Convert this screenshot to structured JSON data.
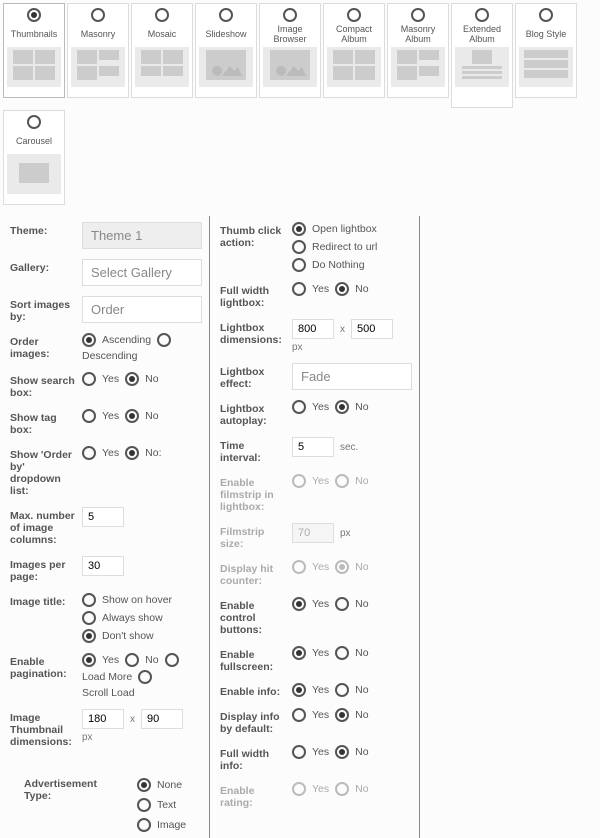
{
  "layouts": [
    {
      "label": "Thumbnails",
      "preview": "grid",
      "selected": true
    },
    {
      "label": "Masonry",
      "preview": "masonry",
      "selected": false
    },
    {
      "label": "Mosaic",
      "preview": "mosaic",
      "selected": false
    },
    {
      "label": "Slideshow",
      "preview": "single",
      "selected": false
    },
    {
      "label": "Image Browser",
      "preview": "single",
      "selected": false
    },
    {
      "label": "Compact Album",
      "preview": "grid",
      "selected": false
    },
    {
      "label": "Masonry Album",
      "preview": "masonry",
      "selected": false
    },
    {
      "label": "Extended Album",
      "preview": "extended",
      "selected": false
    },
    {
      "label": "Blog Style",
      "preview": "blog",
      "selected": false
    },
    {
      "label": "Carousel",
      "preview": "carousel",
      "selected": false
    }
  ],
  "left": {
    "theme_label": "Theme:",
    "theme_value": "Theme 1",
    "gallery_label": "Gallery:",
    "gallery_value": "Select Gallery",
    "sort_label": "Sort images by:",
    "sort_value": "Order",
    "order_label": "Order images:",
    "order_asc": "Ascending",
    "order_desc": "Descending",
    "searchbox_label": "Show search box:",
    "yes": "Yes",
    "no": "No",
    "tagbox_label": "Show tag box:",
    "orderby_label": "Show 'Order by' dropdown list:",
    "no_colon": "No:",
    "maxcols_label": "Max. number of image columns:",
    "maxcols_value": "5",
    "perpage_label": "Images per page:",
    "perpage_value": "30",
    "imgtitle_label": "Image title:",
    "imgtitle_hover": "Show on hover",
    "imgtitle_always": "Always show",
    "imgtitle_dont": "Don't show",
    "pagination_label": "Enable pagination:",
    "pag_yes": "Yes",
    "pag_no": "No",
    "pag_loadmore": "Load More",
    "pag_scroll": "Scroll Load",
    "thumbdim_label": "Image Thumbnail dimensions:",
    "thumb_w": "180",
    "x": "x",
    "thumb_h": "90",
    "px": "px"
  },
  "right": {
    "thumbclick_label": "Thumb click action:",
    "open_lb": "Open lightbox",
    "redirect": "Redirect to url",
    "donothing": "Do Nothing",
    "fullwidth_lb_label": "Full width lightbox:",
    "yes": "Yes",
    "no": "No",
    "lbdim_label": "Lightbox dimensions:",
    "lb_w": "800",
    "x": "x",
    "lb_h": "500",
    "px": "px",
    "lbeffect_label": "Lightbox effect:",
    "lbeffect_value": "Fade",
    "lbautoplay_label": "Lightbox autoplay:",
    "interval_label": "Time interval:",
    "interval_value": "5",
    "sec": "sec.",
    "filmstrip_label": "Enable filmstrip in lightbox:",
    "filmsize_label": "Filmstrip size:",
    "filmsize_value": "70",
    "hitcounter_label": "Display hit counter:",
    "ctrlbtn_label": "Enable control buttons:",
    "fullscreen_label": "Enable fullscreen:",
    "info_label": "Enable info:",
    "infodefault_label": "Display info by default:",
    "fullwidthinfo_label": "Full width info:",
    "rating_label": "Enable rating:"
  },
  "ad": {
    "label": "Advertisement Type:",
    "none": "None",
    "text": "Text",
    "image": "Image"
  }
}
